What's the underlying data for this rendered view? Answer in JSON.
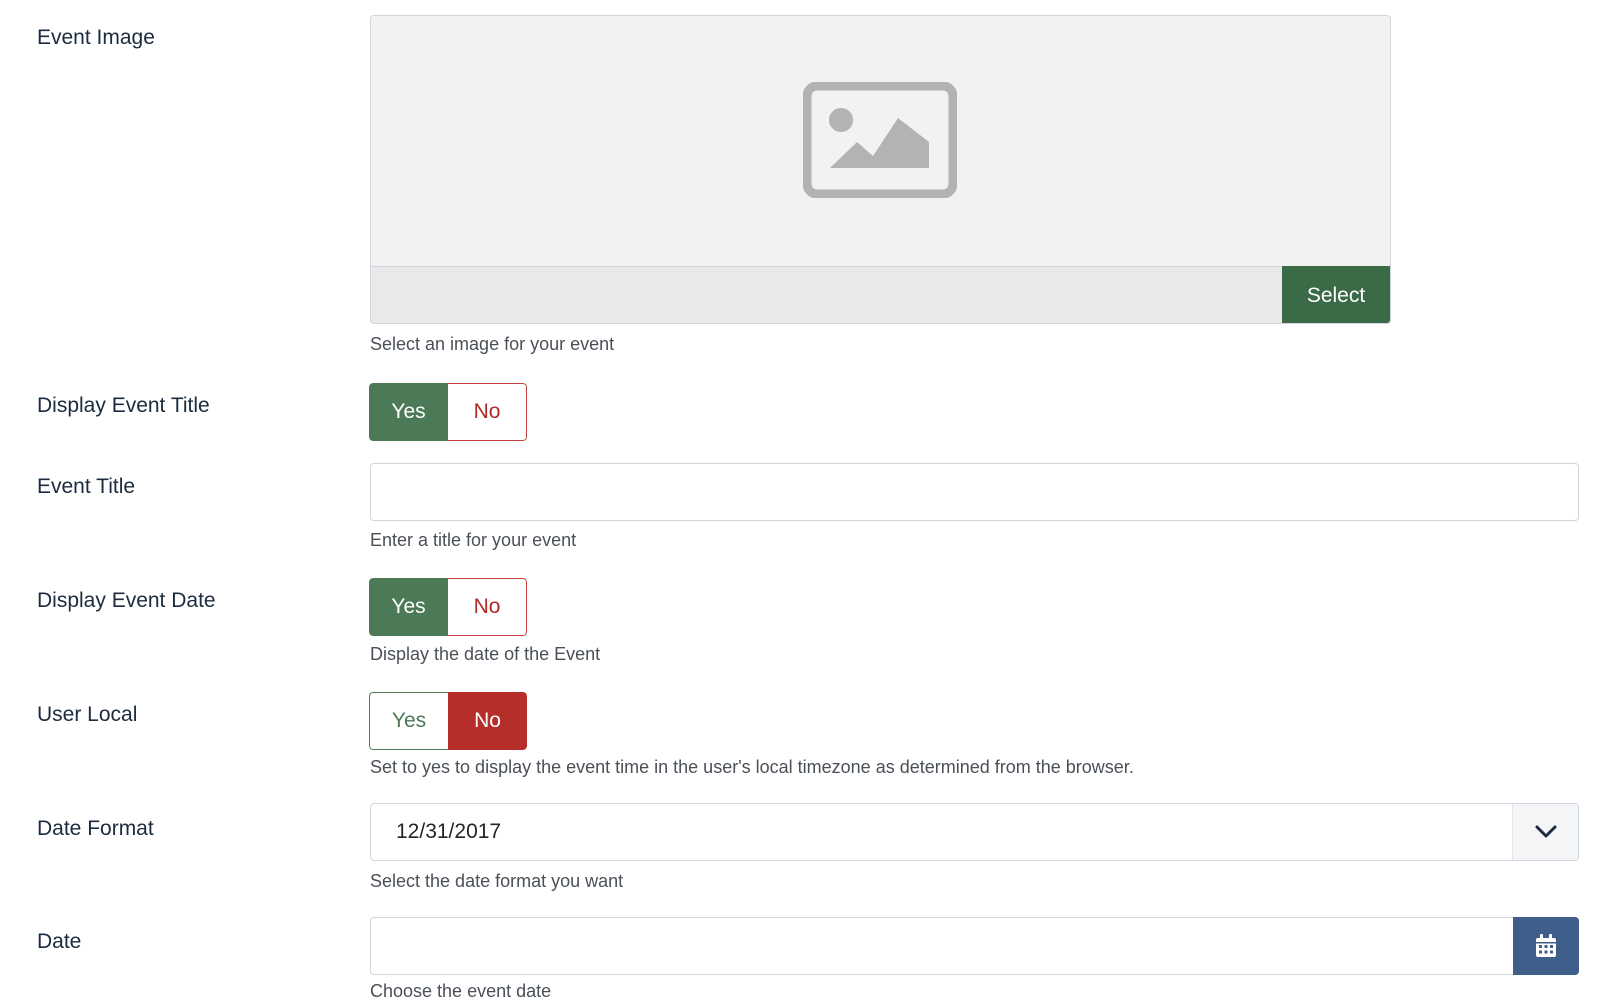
{
  "fields": {
    "event_image": {
      "label": "Event Image",
      "path_value": "",
      "select_label": "Select",
      "description": "Select an image for your event",
      "icon": "image-placeholder-icon"
    },
    "display_event_title": {
      "label": "Display Event Title",
      "yes_label": "Yes",
      "no_label": "No",
      "selected": "Yes"
    },
    "event_title": {
      "label": "Event Title",
      "value": "",
      "description": "Enter a title for your event"
    },
    "display_event_date": {
      "label": "Display Event Date",
      "yes_label": "Yes",
      "no_label": "No",
      "selected": "Yes",
      "description": "Display the date of the Event"
    },
    "user_local": {
      "label": "User Local",
      "yes_label": "Yes",
      "no_label": "No",
      "selected": "No",
      "description": "Set to yes to display the event time in the user's local timezone as determined from the browser."
    },
    "date_format": {
      "label": "Date Format",
      "selected_value": "12/31/2017",
      "description": "Select the date format you want",
      "icon": "chevron-down-icon"
    },
    "date": {
      "label": "Date",
      "value": "",
      "description": "Choose the event date",
      "icon": "calendar-icon"
    }
  },
  "colors": {
    "yes_active": "#4c7a56",
    "no_active": "#b52e2a",
    "select_button": "#3b6a46",
    "calendar_button": "#3f5f8a",
    "label_text": "#1c2b3f"
  }
}
